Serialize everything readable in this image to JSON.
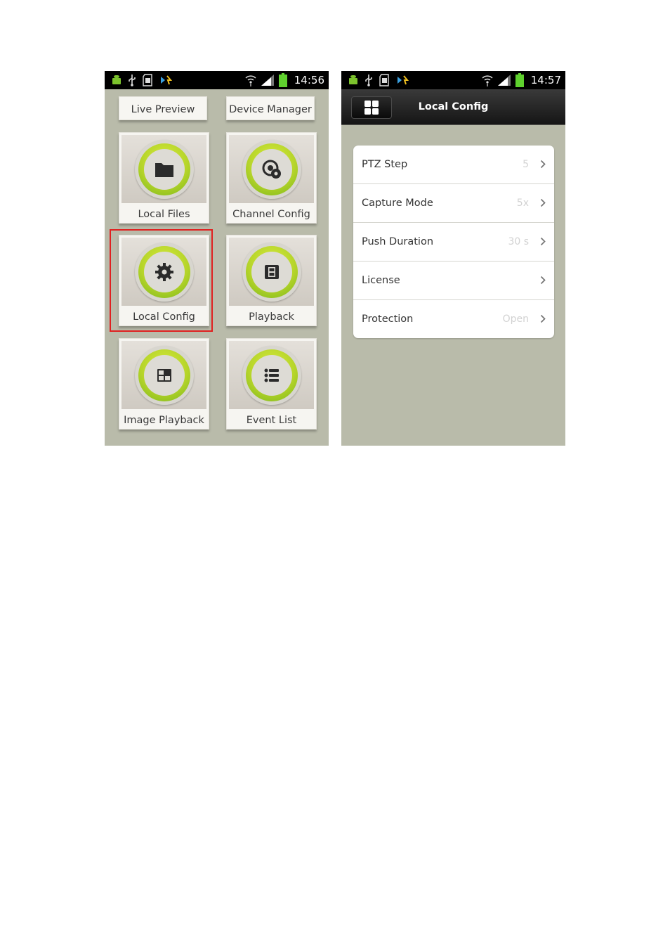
{
  "left_screen": {
    "status": {
      "time": "14:56"
    },
    "top_buttons": [
      "Live Preview",
      "Device Manager"
    ],
    "tiles": [
      {
        "label": "Local Files",
        "icon": "folder-icon"
      },
      {
        "label": "Channel Config",
        "icon": "channel-config-icon"
      },
      {
        "label": "Local Config",
        "icon": "gear-icon"
      },
      {
        "label": "Playback",
        "icon": "film-icon"
      },
      {
        "label": "Image Playback",
        "icon": "image-grid-icon"
      },
      {
        "label": "Event List",
        "icon": "list-icon"
      }
    ],
    "highlighted_tile": "Local Config",
    "highlight_color": "#e02020"
  },
  "right_screen": {
    "status": {
      "time": "14:57"
    },
    "title": "Local Config",
    "rows": [
      {
        "label": "PTZ Step",
        "value": "5"
      },
      {
        "label": "Capture Mode",
        "value": "5x"
      },
      {
        "label": "Push Duration",
        "value": "30 s"
      },
      {
        "label": "License",
        "value": ""
      },
      {
        "label": "Protection",
        "value": "Open"
      }
    ]
  },
  "colors": {
    "background": "#b9bbaa",
    "accent_green": "#b5d42a",
    "battery_green": "#5fd12e"
  }
}
